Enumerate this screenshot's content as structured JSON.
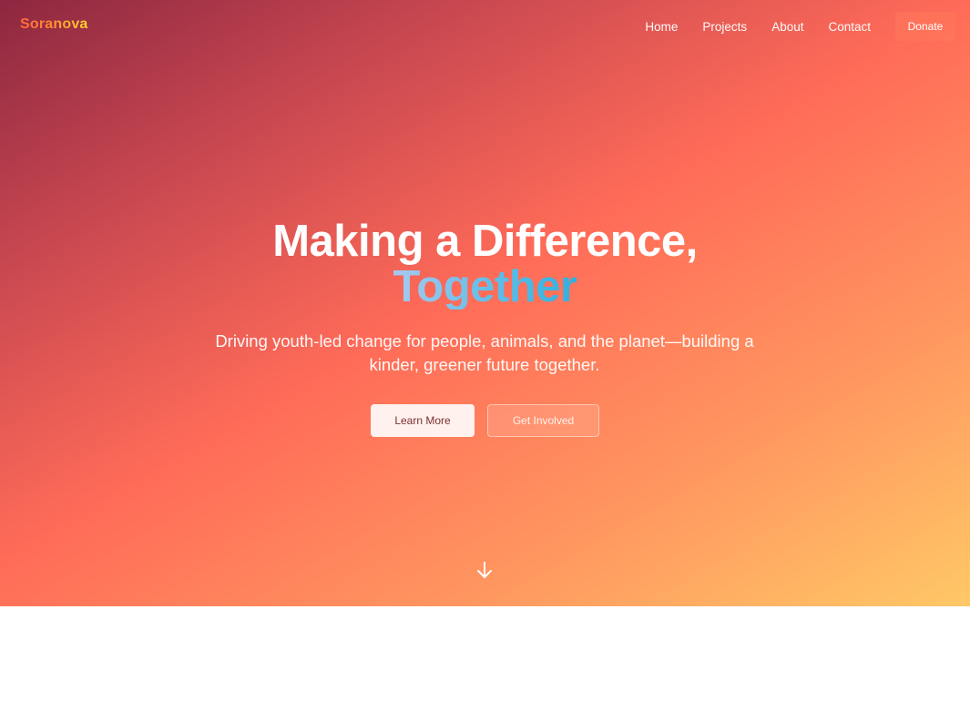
{
  "brand": {
    "logo_text": "Soranova"
  },
  "nav": {
    "links": [
      "Home",
      "Projects",
      "About",
      "Contact"
    ],
    "donate_label": "Donate"
  },
  "hero": {
    "headline_line1": "Making a Difference,",
    "headline_accent": "Together",
    "subtitle": "Driving youth-led change for people, animals, and the planet—building a kinder, greener future together.",
    "primary_button": "Learn More",
    "secondary_button": "Get Involved",
    "scroll_icon": "arrow-down-icon"
  },
  "colors": {
    "gradient_start": "#8c2740",
    "gradient_mid": "#ff6b58",
    "gradient_end": "#ffc866",
    "accent_text_start": "#a8c9ee",
    "accent_text_end": "#2fb0e0",
    "logo_start": "#ff6a3a",
    "logo_end": "#ffd52e"
  }
}
